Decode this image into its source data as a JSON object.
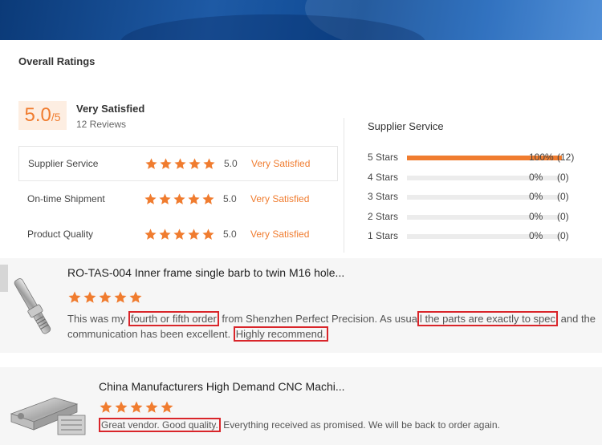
{
  "overall": {
    "title": "Overall Ratings",
    "score": "5.0",
    "score_max": "/5",
    "label": "Very Satisfied",
    "review_count": "12 Reviews",
    "accent_color": "#f07c2f"
  },
  "ratings": [
    {
      "name": "Supplier Service",
      "stars": 5,
      "value": "5.0",
      "label": "Very Satisfied"
    },
    {
      "name": "On-time Shipment",
      "stars": 5,
      "value": "5.0",
      "label": "Very Satisfied"
    },
    {
      "name": "Product Quality",
      "stars": 5,
      "value": "5.0",
      "label": "Very Satisfied"
    }
  ],
  "distribution": {
    "title": "Supplier Service",
    "rows": [
      {
        "label": "5 Stars",
        "fraction": 1.0,
        "percent": "100%",
        "count": "(12)"
      },
      {
        "label": "4 Stars",
        "fraction": 0.0,
        "percent": "0%",
        "count": "(0)"
      },
      {
        "label": "3 Stars",
        "fraction": 0.0,
        "percent": "0%",
        "count": "(0)"
      },
      {
        "label": "2 Stars",
        "fraction": 0.0,
        "percent": "0%",
        "count": "(0)"
      },
      {
        "label": "1 Stars",
        "fraction": 0.0,
        "percent": "0%",
        "count": "(0)"
      }
    ]
  },
  "reviews": [
    {
      "product_title": "RO-TAS-004 Inner frame single barb to twin M16 hole...",
      "stars": 5,
      "text_parts": [
        {
          "text": "This was my ",
          "highlight": false
        },
        {
          "text": "fourth or fifth order",
          "highlight": true
        },
        {
          "text": " from Shenzhen Perfect Precision. As usua",
          "highlight": false
        },
        {
          "text": "l the parts are exactly to spec",
          "highlight": true
        },
        {
          "text": " and the communication has been excellent. ",
          "highlight": false
        },
        {
          "text": "Highly recommend.",
          "highlight": true
        }
      ]
    },
    {
      "product_title": "China Manufacturers High Demand CNC Machi...",
      "stars": 5,
      "text_parts": [
        {
          "text": "Great vendor. Good quality.",
          "highlight": true
        },
        {
          "text": " Everything received as promised. We will be back to order again.",
          "highlight": false
        }
      ]
    }
  ]
}
